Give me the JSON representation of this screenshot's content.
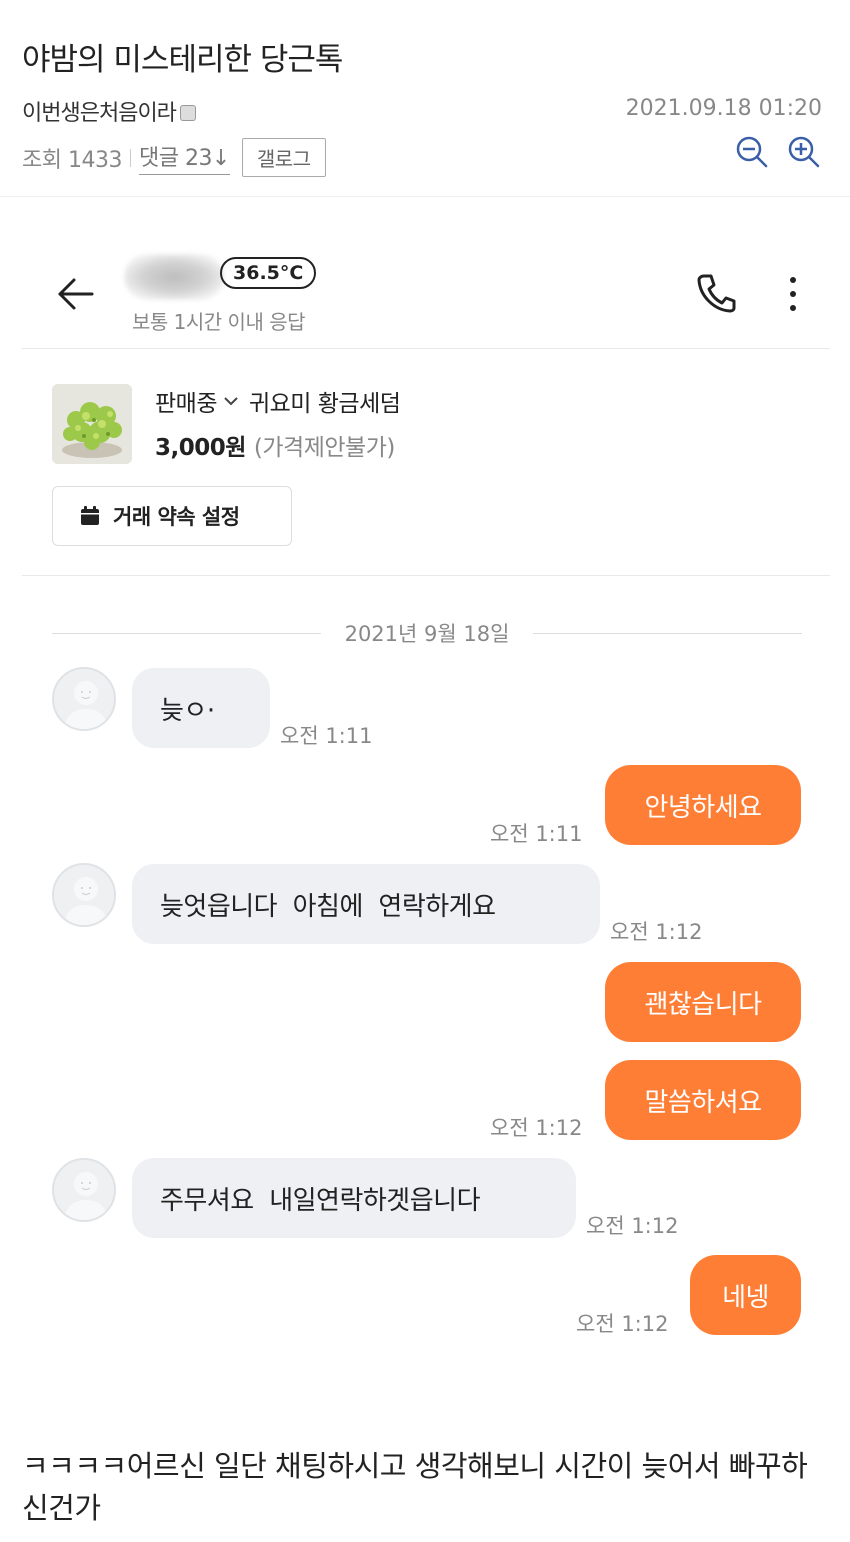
{
  "post": {
    "title": "야밤의 미스테리한 당근톡",
    "author": "이번생은처음이라",
    "date": "2021.09.18 01:20",
    "views": "조회 1433",
    "comments": "댓글 23↓",
    "gallog_label": "갤로그"
  },
  "chat_header": {
    "temperature": "36.5°C",
    "response_time": "보통 1시간 이내 응답"
  },
  "product": {
    "status": "판매중",
    "name": "귀요미 황금세덤",
    "price": "3,000원",
    "price_note": "(가격제안불가)",
    "schedule_button": "거래 약속 설정"
  },
  "chat_date": "2021년 9월 18일",
  "messages": [
    {
      "from": "them",
      "text": "늦ㅇ·",
      "time": "오전 1:11"
    },
    {
      "from": "me",
      "text": "안녕하세요",
      "time": "오전 1:11"
    },
    {
      "from": "them",
      "text": "늦엇읍니다  아침에  연락하게요",
      "time": "오전 1:12"
    },
    {
      "from": "me",
      "text": "괜찮습니다",
      "time": ""
    },
    {
      "from": "me",
      "text": "말씀하셔요",
      "time": "오전 1:12"
    },
    {
      "from": "them",
      "text": "주무셔요  내일연락하겟읍니다",
      "time": "오전 1:12"
    },
    {
      "from": "me",
      "text": "네넹",
      "time": "오전 1:12"
    }
  ],
  "caption": "ㅋㅋㅋㅋ어르신 일단 채팅하시고 생각해보니 시간이 늦어서 빠꾸하신건가",
  "colors": {
    "accent": "#ff7e36",
    "bubble_in": "#eef0f3",
    "muted_text": "#888888"
  },
  "icons": [
    "zoom-out-icon",
    "zoom-in-icon",
    "back-arrow-icon",
    "phone-icon",
    "more-vertical-icon",
    "chevron-down-icon",
    "calendar-icon",
    "default-avatar-icon",
    "author-badge-icon"
  ]
}
